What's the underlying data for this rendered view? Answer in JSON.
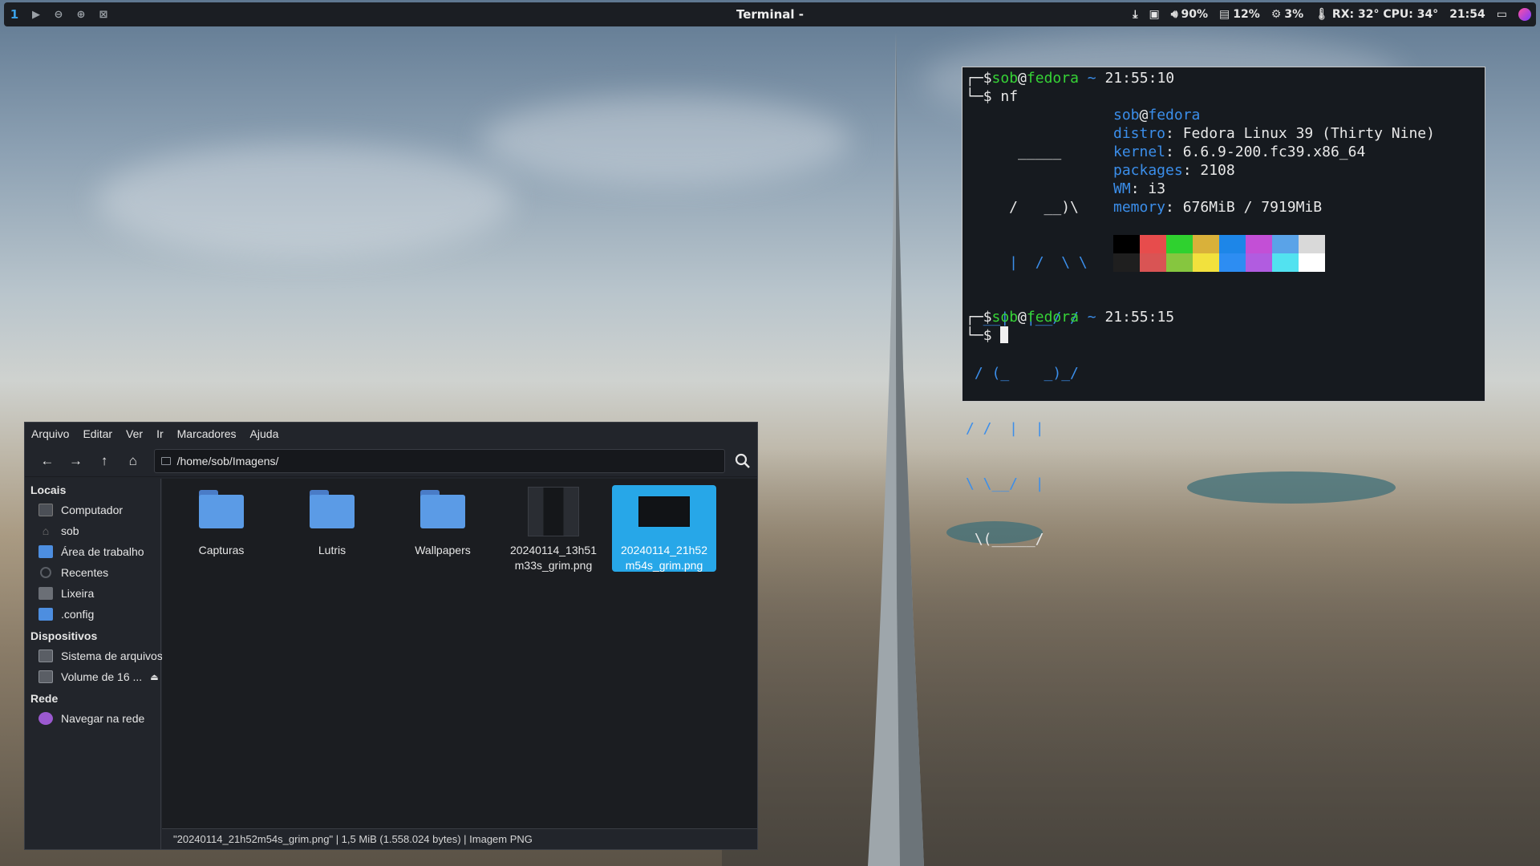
{
  "topbar": {
    "workspace": "1",
    "title": "Terminal -",
    "volume": "90%",
    "memory": "12%",
    "cpu": "3%",
    "temps": "RX: 32° CPU: 34°",
    "clock": "21:54"
  },
  "terminal": {
    "line1": {
      "bracket": "┌─",
      "dollar": "$",
      "user": "sob",
      "at": "@",
      "host": "fedora",
      "tilde": "~",
      "time": "21:55:10"
    },
    "line2": {
      "bracket": "└─",
      "prompt": "$ nf"
    },
    "ascii": [
      "      _____",
      "     /   __)\\",
      "     |  /  \\ \\",
      "  __|  |__/ /",
      " / (_    _)_/",
      "/ /  |  |",
      "\\ \\__/  |",
      " \\(_____/"
    ],
    "info": {
      "user": "sob",
      "at": "@",
      "host": "fedora",
      "rows": [
        {
          "key": "distro",
          "value": " Fedora Linux 39 (Thirty Nine)"
        },
        {
          "key": "kernel",
          "value": " 6.6.9-200.fc39.x86_64"
        },
        {
          "key": "packages",
          "value": " 2108"
        },
        {
          "key": "WM",
          "value": " i3"
        },
        {
          "key": "memory",
          "value": " 676MiB / 7919MiB"
        }
      ]
    },
    "palette_top": [
      "#000000",
      "#e74c4c",
      "#2fd12f",
      "#d9b13a",
      "#1d86e8",
      "#c34fd6",
      "#5aa3e8",
      "#d9d9d9"
    ],
    "palette_bottom": [
      "#1f1f1f",
      "#d95454",
      "#86c63f",
      "#f2e13d",
      "#2d8df2",
      "#b15ce0",
      "#52e2f0",
      "#ffffff"
    ],
    "line3": {
      "bracket": "┌─",
      "dollar": "$",
      "user": "sob",
      "at": "@",
      "host": "fedora",
      "tilde": "~",
      "time": "21:55:15"
    },
    "line4": {
      "bracket": "└─",
      "prompt": "$ "
    }
  },
  "filemanager": {
    "menu": [
      "Arquivo",
      "Editar",
      "Ver",
      "Ir",
      "Marcadores",
      "Ajuda"
    ],
    "path": "/home/sob/Imagens/",
    "sidebar": {
      "locais_heading": "Locais",
      "locais": [
        "Computador",
        "sob",
        "Área de trabalho",
        "Recentes",
        "Lixeira",
        ".config"
      ],
      "dispositivos_heading": "Dispositivos",
      "dispositivos": [
        "Sistema de arquivos",
        "Volume de 16 ..."
      ],
      "rede_heading": "Rede",
      "rede": [
        "Navegar na rede"
      ]
    },
    "files": [
      {
        "name": "Capturas"
      },
      {
        "name": "Lutris"
      },
      {
        "name": "Wallpapers"
      },
      {
        "name": "20240114_13h51m33s_grim.png"
      },
      {
        "name": "20240114_21h52m54s_grim.png"
      }
    ],
    "status": "\"20240114_21h52m54s_grim.png\"  |  1,5 MiB (1.558.024 bytes)  |  Imagem PNG"
  }
}
